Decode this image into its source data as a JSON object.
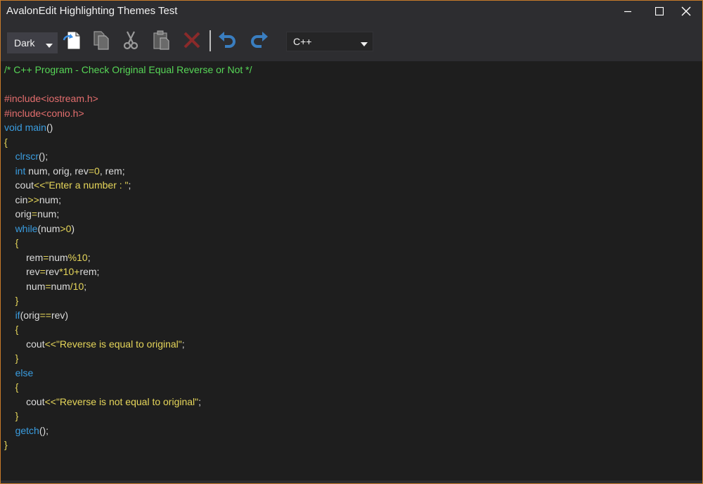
{
  "window": {
    "title": "AvalonEdit Highlighting Themes Test",
    "accent_color": "#c77a2a"
  },
  "toolbar": {
    "theme_selected": "Dark",
    "language_selected": "C++",
    "buttons": [
      {
        "name": "new-document-icon"
      },
      {
        "name": "copy-icon"
      },
      {
        "name": "cut-icon"
      },
      {
        "name": "paste-icon"
      },
      {
        "name": "delete-icon"
      },
      {
        "name": "undo-icon"
      },
      {
        "name": "redo-icon"
      }
    ]
  },
  "editor": {
    "lines": [
      [
        {
          "c": "comment",
          "t": "/* C++ Program - Check Original Equal Reverse or Not */"
        }
      ],
      [],
      [
        {
          "c": "preproc",
          "t": "#include<iostream.h>"
        }
      ],
      [
        {
          "c": "preproc",
          "t": "#include<conio.h>"
        }
      ],
      [
        {
          "c": "keyword",
          "t": "void"
        },
        {
          "c": "plain",
          "t": " "
        },
        {
          "c": "fn",
          "t": "main"
        },
        {
          "c": "plain",
          "t": "()"
        }
      ],
      [
        {
          "c": "brace",
          "t": "{"
        }
      ],
      [
        {
          "c": "plain",
          "t": "    "
        },
        {
          "c": "fn",
          "t": "clrscr"
        },
        {
          "c": "plain",
          "t": "();"
        }
      ],
      [
        {
          "c": "plain",
          "t": "    "
        },
        {
          "c": "keyword",
          "t": "int"
        },
        {
          "c": "plain",
          "t": " num, orig, rev"
        },
        {
          "c": "op",
          "t": "="
        },
        {
          "c": "num",
          "t": "0"
        },
        {
          "c": "plain",
          "t": ", rem;"
        }
      ],
      [
        {
          "c": "plain",
          "t": "    cout"
        },
        {
          "c": "op",
          "t": "<<"
        },
        {
          "c": "str",
          "t": "\"Enter a number : \""
        },
        {
          "c": "plain",
          "t": ";"
        }
      ],
      [
        {
          "c": "plain",
          "t": "    cin"
        },
        {
          "c": "op",
          "t": ">>"
        },
        {
          "c": "plain",
          "t": "num;"
        }
      ],
      [
        {
          "c": "plain",
          "t": "    orig"
        },
        {
          "c": "op",
          "t": "="
        },
        {
          "c": "plain",
          "t": "num;"
        }
      ],
      [
        {
          "c": "plain",
          "t": "    "
        },
        {
          "c": "keyword",
          "t": "while"
        },
        {
          "c": "plain",
          "t": "(num"
        },
        {
          "c": "op",
          "t": ">"
        },
        {
          "c": "num",
          "t": "0"
        },
        {
          "c": "plain",
          "t": ")"
        }
      ],
      [
        {
          "c": "plain",
          "t": "    "
        },
        {
          "c": "brace",
          "t": "{"
        }
      ],
      [
        {
          "c": "plain",
          "t": "        rem"
        },
        {
          "c": "op",
          "t": "="
        },
        {
          "c": "plain",
          "t": "num"
        },
        {
          "c": "op",
          "t": "%"
        },
        {
          "c": "num",
          "t": "10"
        },
        {
          "c": "plain",
          "t": ";"
        }
      ],
      [
        {
          "c": "plain",
          "t": "        rev"
        },
        {
          "c": "op",
          "t": "="
        },
        {
          "c": "plain",
          "t": "rev"
        },
        {
          "c": "op",
          "t": "*"
        },
        {
          "c": "num",
          "t": "10"
        },
        {
          "c": "op",
          "t": "+"
        },
        {
          "c": "plain",
          "t": "rem;"
        }
      ],
      [
        {
          "c": "plain",
          "t": "        num"
        },
        {
          "c": "op",
          "t": "="
        },
        {
          "c": "plain",
          "t": "num"
        },
        {
          "c": "op",
          "t": "/"
        },
        {
          "c": "num",
          "t": "10"
        },
        {
          "c": "plain",
          "t": ";"
        }
      ],
      [
        {
          "c": "plain",
          "t": "    "
        },
        {
          "c": "brace",
          "t": "}"
        }
      ],
      [
        {
          "c": "plain",
          "t": "    "
        },
        {
          "c": "keyword",
          "t": "if"
        },
        {
          "c": "plain",
          "t": "(orig"
        },
        {
          "c": "op",
          "t": "=="
        },
        {
          "c": "plain",
          "t": "rev)"
        }
      ],
      [
        {
          "c": "plain",
          "t": "    "
        },
        {
          "c": "brace",
          "t": "{"
        }
      ],
      [
        {
          "c": "plain",
          "t": "        cout"
        },
        {
          "c": "op",
          "t": "<<"
        },
        {
          "c": "str",
          "t": "\"Reverse is equal to original\""
        },
        {
          "c": "plain",
          "t": ";"
        }
      ],
      [
        {
          "c": "plain",
          "t": "    "
        },
        {
          "c": "brace",
          "t": "}"
        }
      ],
      [
        {
          "c": "plain",
          "t": "    "
        },
        {
          "c": "keyword",
          "t": "else"
        }
      ],
      [
        {
          "c": "plain",
          "t": "    "
        },
        {
          "c": "brace",
          "t": "{"
        }
      ],
      [
        {
          "c": "plain",
          "t": "        cout"
        },
        {
          "c": "op",
          "t": "<<"
        },
        {
          "c": "str",
          "t": "\"Reverse is not equal to original\""
        },
        {
          "c": "plain",
          "t": ";"
        }
      ],
      [
        {
          "c": "plain",
          "t": "    "
        },
        {
          "c": "brace",
          "t": "}"
        }
      ],
      [
        {
          "c": "plain",
          "t": "    "
        },
        {
          "c": "fn",
          "t": "getch"
        },
        {
          "c": "plain",
          "t": "();"
        }
      ],
      [
        {
          "c": "brace",
          "t": "}"
        }
      ]
    ]
  }
}
